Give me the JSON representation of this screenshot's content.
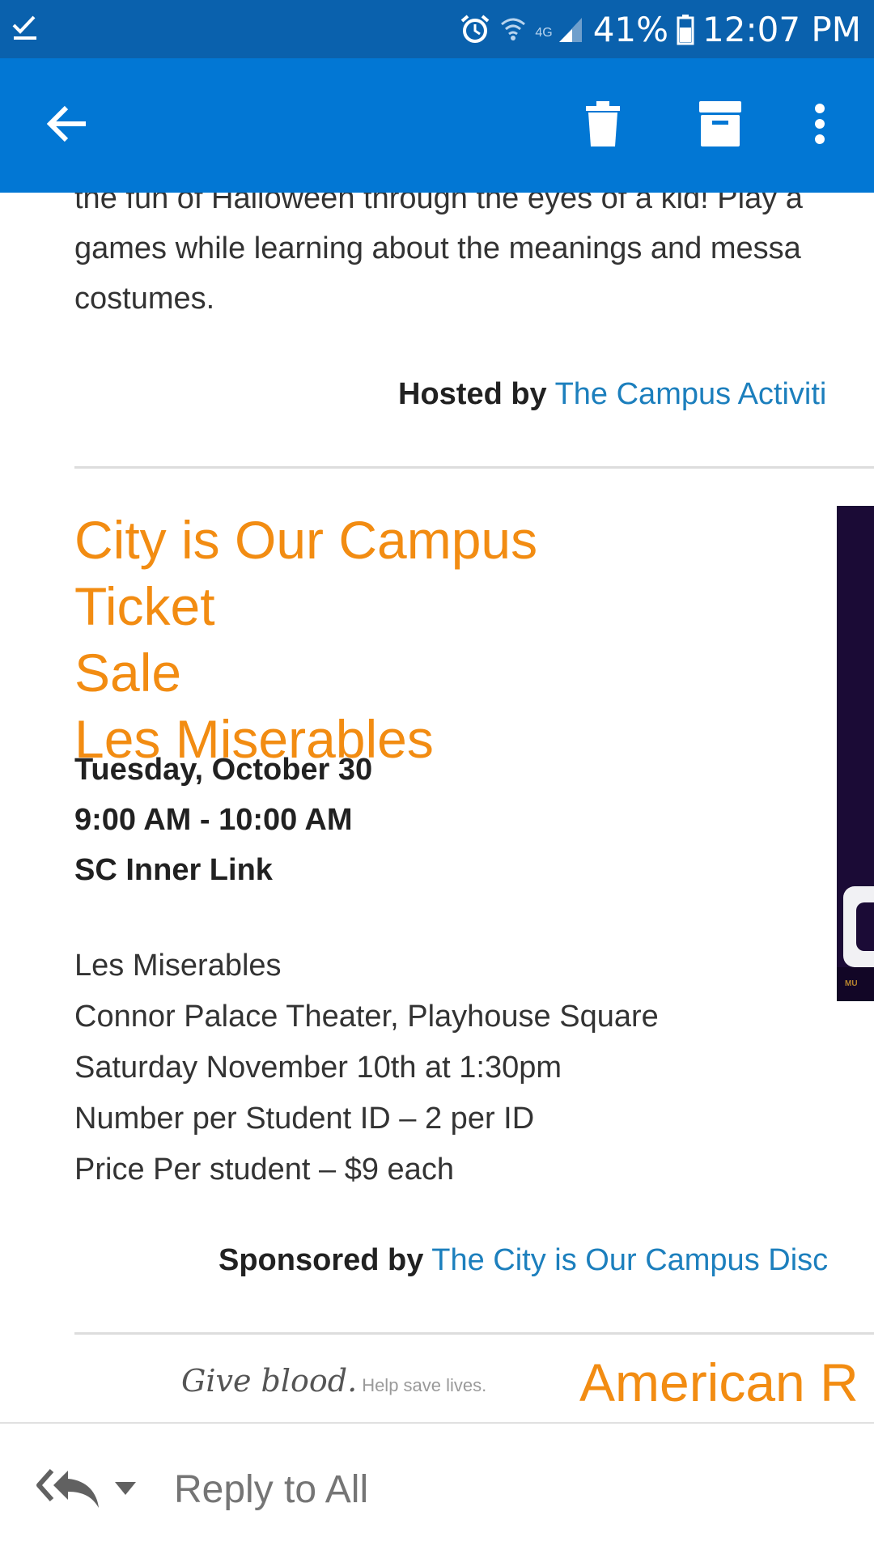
{
  "status_bar": {
    "icons": [
      "checkmark-download-icon",
      "alarm-icon",
      "wifi-icon",
      "signal-icon",
      "battery-icon"
    ],
    "network": "4G",
    "battery": "41%",
    "time": "12:07 PM"
  },
  "app_bar": {
    "icons": [
      "back-arrow-icon",
      "delete-icon",
      "archive-icon",
      "more-vert-icon"
    ],
    "color": "#0277d4",
    "status_color": "#0a61ad"
  },
  "previous_event": {
    "description_lines": [
      "the fun of Halloween through the eyes of a kid! Play a",
      "games while learning about the meanings and messa",
      "costumes."
    ],
    "host_label": "Hosted by",
    "host_link": "The Campus Activiti"
  },
  "event": {
    "title_line1": "City is Our Campus Ticket",
    "title_line2": "Sale",
    "title_line3": "Les Miserables",
    "date": "Tuesday, October 30",
    "time": "9:00 AM - 10:00 AM",
    "location": "SC Inner Link",
    "details": [
      "Les Miserables",
      "Connor Palace Theater, Playhouse Square",
      "Saturday November 10th at 1:30pm",
      "Number per Student ID – 2 per ID",
      "Price Per student – $9 each"
    ],
    "sponsor_label": "Sponsored by",
    "sponsor_link": "The City is Our Campus Disc",
    "poster_text": "MU",
    "title_color": "#f28c12",
    "link_color": "#1c7fbd"
  },
  "next_event": {
    "image_text": "Give blood.",
    "image_tagline": "Help save lives.",
    "title": "American R"
  },
  "reply_bar": {
    "label": "Reply to All",
    "icons": [
      "reply-all-icon",
      "chevron-down-icon"
    ]
  }
}
